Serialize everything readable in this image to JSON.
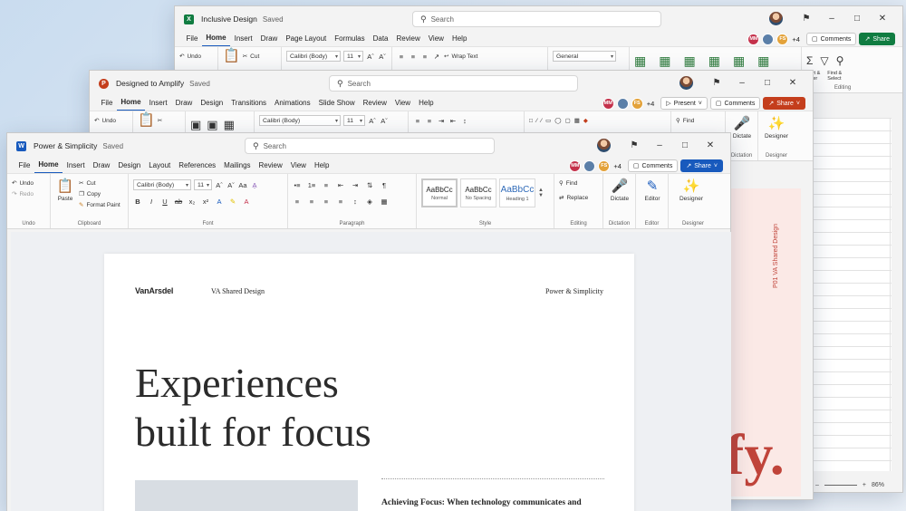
{
  "excel": {
    "title": "Inclusive Design",
    "saved": "Saved",
    "search": "Search",
    "menu": [
      "File",
      "Home",
      "Insert",
      "Draw",
      "Page Layout",
      "Formulas",
      "Data",
      "Review",
      "View",
      "Help"
    ],
    "collab": {
      "initials": "MM",
      "fs": "FS",
      "count": "+4"
    },
    "comments": "Comments",
    "share": "Share",
    "ribbon": {
      "undo": "Undo",
      "cut": "Cut",
      "font": "Calibri (Body)",
      "size": "11",
      "wrap": "Wrap Text",
      "format": "General",
      "sort": "Sort &\nFilter",
      "find": "Find &\nSelect",
      "editing": "Editing"
    },
    "zoom": "86%"
  },
  "ppt": {
    "title": "Designed to Amplify",
    "saved": "Saved",
    "search": "Search",
    "menu": [
      "File",
      "Home",
      "Insert",
      "Draw",
      "Design",
      "Transitions",
      "Animations",
      "Slide Show",
      "Review",
      "View",
      "Help"
    ],
    "collab": {
      "initials": "MM",
      "fs": "FS",
      "count": "+4"
    },
    "present": "Present",
    "comments": "Comments",
    "share": "Share",
    "ribbon": {
      "undo": "Undo",
      "font": "Calibri (Body)",
      "size": "11",
      "find": "Find",
      "replace": "Replace",
      "dictate": "Dictate",
      "designer": "Designer",
      "dictation": "Dictation",
      "designer_group": "Designer"
    },
    "slide": {
      "vertical_label": "P01   VA Shared Design",
      "big_text": "fy."
    }
  },
  "word": {
    "title": "Power & Simplicity",
    "saved": "Saved",
    "search": "Search",
    "menu": [
      "File",
      "Home",
      "Insert",
      "Draw",
      "Design",
      "Layout",
      "References",
      "Mailings",
      "Review",
      "View",
      "Help"
    ],
    "collab": {
      "initials": "MM",
      "fs": "FS",
      "count": "+4"
    },
    "comments": "Comments",
    "share": "Share",
    "ribbon": {
      "undo": "Undo",
      "redo": "Redo",
      "paste": "Paste",
      "cut": "Cut",
      "copy": "Copy",
      "format_paint": "Format Paint",
      "font": "Calibri (Body)",
      "size": "11",
      "style_normal": "Normal",
      "style_nospacing": "No Spacing",
      "style_heading": "Heading 1",
      "style_sample": "AaBbCc",
      "find": "Find",
      "replace": "Replace",
      "dictate": "Dictate",
      "editor": "Editor",
      "designer": "Designer",
      "groups": {
        "undo": "Undo",
        "clipboard": "Clipboard",
        "font": "Font",
        "paragraph": "Paragraph",
        "style": "Style",
        "editing": "Editing",
        "dictation": "Dictation",
        "editor": "Editor",
        "designer": "Designer"
      }
    },
    "doc": {
      "logo": "VanArsdel",
      "header_center": "VA Shared Design",
      "header_right": "Power & Simplicity",
      "headline_1": "Experiences",
      "headline_2": "built for focus",
      "subhead": "Achieving Focus: When technology communicates and"
    }
  },
  "colors": {
    "excel_green": "#107c41",
    "ppt_red": "#c43e1c",
    "word_blue": "#185abd",
    "accent_red": "#c0443a"
  }
}
